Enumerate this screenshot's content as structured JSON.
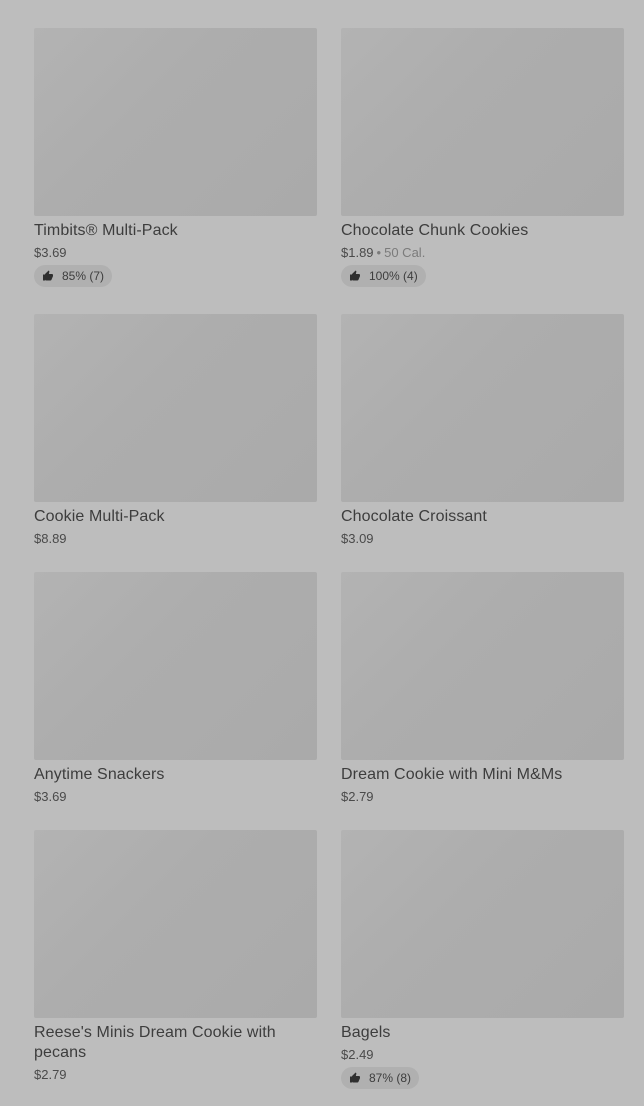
{
  "items": [
    {
      "name": "Timbits® Multi-Pack",
      "price": "$3.69",
      "calories": "",
      "rating": "85% (7)"
    },
    {
      "name": "Chocolate Chunk Cookies",
      "price": "$1.89",
      "calories": "50 Cal.",
      "rating": "100% (4)"
    },
    {
      "name": "Cookie Multi-Pack",
      "price": "$8.89",
      "calories": "",
      "rating": ""
    },
    {
      "name": "Chocolate Croissant",
      "price": "$3.09",
      "calories": "",
      "rating": ""
    },
    {
      "name": "Anytime Snackers",
      "price": "$3.69",
      "calories": "",
      "rating": ""
    },
    {
      "name": "Dream Cookie with Mini M&Ms",
      "price": "$2.79",
      "calories": "",
      "rating": ""
    },
    {
      "name": "Reese's Minis Dream Cookie with pecans",
      "price": "$2.79",
      "calories": "",
      "rating": ""
    },
    {
      "name": "Bagels",
      "price": "$2.49",
      "calories": "",
      "rating": "87% (8)"
    }
  ],
  "icons": {
    "rating": "thumbs-up-icon"
  }
}
